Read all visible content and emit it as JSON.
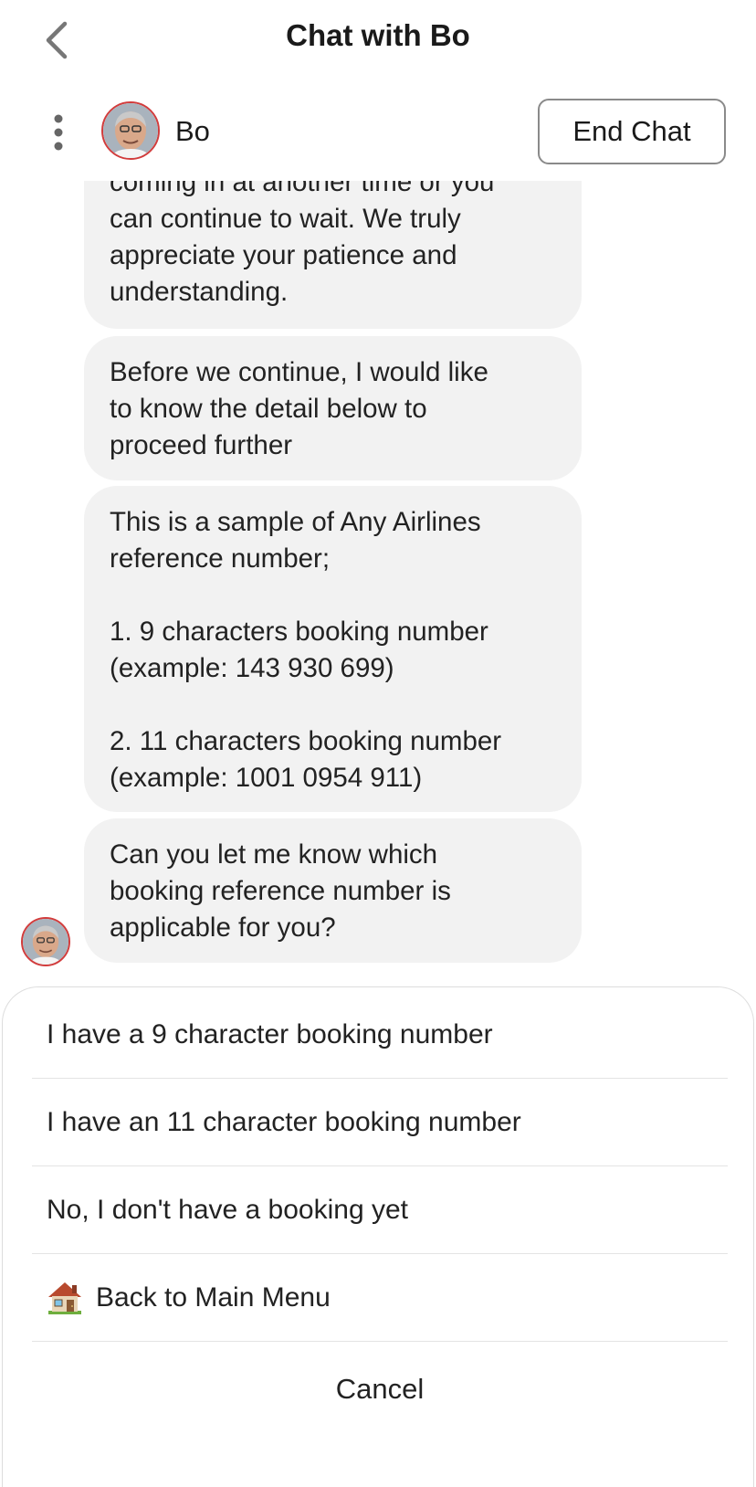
{
  "header": {
    "title": "Chat with Bo",
    "back_icon": "chevron-left-icon"
  },
  "agent_bar": {
    "menu_icon": "kebab-menu-icon",
    "agent_name": "Bo",
    "end_chat_label": "End Chat"
  },
  "messages": [
    {
      "sender": "Bo",
      "text": "coming in at another time or you\ncan continue to wait. We truly\nappreciate your patience and\nunderstanding."
    },
    {
      "sender": "Bo",
      "text": "Before we continue, I would like\nto know the detail below to\nproceed further"
    },
    {
      "sender": "Bo",
      "text": "This is a sample of Any Airlines\nreference number;\n\n1. 9 characters booking number\n(example: 143 930 699)\n\n2. 11 characters booking number\n(example: 1001 0954 911)"
    },
    {
      "sender": "Bo",
      "text": "Can you let me know which\nbooking reference number is\napplicable for you?"
    }
  ],
  "quick_replies": {
    "options": [
      {
        "label": "I have a 9 character booking number"
      },
      {
        "label": "I have an 11 character booking number"
      },
      {
        "label": "No, I don't have a booking yet"
      },
      {
        "label": "Back to Main Menu",
        "icon": "house-icon"
      }
    ],
    "cancel_label": "Cancel"
  },
  "colors": {
    "bubble_bg": "#f2f2f2",
    "avatar_ring": "#d23c3c",
    "divider": "#e4e4e4"
  }
}
